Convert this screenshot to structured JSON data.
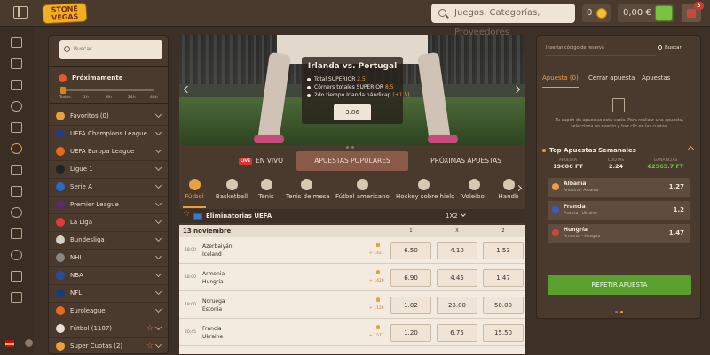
{
  "header": {
    "logo_line1": "STONE",
    "logo_line2": "VEGAS",
    "search_placeholder": "Juegos, Categorías, Proveedores",
    "coins": "0",
    "balance": "0,00 €",
    "notifications_badge": "3"
  },
  "sidebar": {
    "search_placeholder": "Buscar",
    "upcoming": {
      "title": "Próximamente",
      "slider_labels": [
        "Todos",
        "1h",
        "6h",
        "24h",
        "48h"
      ],
      "selected": "Todos"
    },
    "items": [
      {
        "label": "Favoritos (0)"
      },
      {
        "label": "UEFA Champions League"
      },
      {
        "label": "UEFA Europa League"
      },
      {
        "label": "Ligue 1"
      },
      {
        "label": "Serie A"
      },
      {
        "label": "Premier League"
      },
      {
        "label": "La Liga"
      },
      {
        "label": "Bundesliga"
      },
      {
        "label": "NHL"
      },
      {
        "label": "NBA"
      },
      {
        "label": "NFL"
      },
      {
        "label": "Euroleague"
      },
      {
        "label": "Fútbol (1107)"
      },
      {
        "label": "Super Cuotas (2)"
      }
    ]
  },
  "hero": {
    "title": "Irlanda  vs.  Portugal",
    "lines": [
      {
        "label": "Total SUPERIOR",
        "value": "2.5"
      },
      {
        "label": "Córners totales SUPERIOR",
        "value": "8.5"
      },
      {
        "label": "2do tiempo Irlanda hándicap",
        "value": "(+1.5)"
      }
    ],
    "odd": "3.86"
  },
  "tabs": {
    "live_badge": "LIVE",
    "live": "EN VIVO",
    "popular": "APUESTAS POPULARES",
    "upcoming": "PRÓXIMAS APUESTAS"
  },
  "sports": [
    "Fútbol",
    "Basketball",
    "Tenis",
    "Tenis de mesa",
    "Fútbol americano",
    "Hockey sobre hielo",
    "Voleibol",
    "Handb"
  ],
  "competition": {
    "name": "Eliminatorias UEFA",
    "market": "1X2"
  },
  "table": {
    "date": "13 noviembre",
    "cols": [
      "1",
      "X",
      "2"
    ],
    "rows": [
      {
        "time": "18:00",
        "home": "Azerbaiyán",
        "away": "Iceland",
        "more": "+ 1421",
        "odds": [
          "6.50",
          "4.10",
          "1.53"
        ]
      },
      {
        "time": "18:00",
        "home": "Armenia",
        "away": "Hungría",
        "more": "+ 1420",
        "odds": [
          "6.90",
          "4.45",
          "1.47"
        ]
      },
      {
        "time": "18:00",
        "home": "Noruega",
        "away": "Estonia",
        "more": "+ 1126",
        "odds": [
          "1.02",
          "23.00",
          "50.00"
        ]
      },
      {
        "time": "20:45",
        "home": "Francia",
        "away": "Ukraine",
        "more": "+ 1571",
        "odds": [
          "1.20",
          "6.75",
          "15.50"
        ]
      }
    ]
  },
  "betslip": {
    "code_placeholder": "Insertar código de reserva",
    "search": "Buscar",
    "tabs": [
      "Apuesta (0)",
      "Cerrar apuesta",
      "Apuestas"
    ],
    "empty_text": "Tu cupón de apuestas está vacío. Para realizar una apuesta, selecciona un evento y haz clic en las cuotas.",
    "top_title": "Top Apuestas Semanales",
    "stats": [
      {
        "label": "APUESTA",
        "value": "19000 FT"
      },
      {
        "label": "CUOTAS",
        "value": "2.24"
      },
      {
        "label": "GANANCIAS",
        "value": "€2565.7 FT"
      }
    ],
    "picks": [
      {
        "name": "Albania",
        "match": "Andorra - Albania",
        "odd": "1.27"
      },
      {
        "name": "Francia",
        "match": "Francia - Ukraine",
        "odd": "1.2"
      },
      {
        "name": "Hungría",
        "match": "Armenia - Hungría",
        "odd": "1.47"
      }
    ],
    "repeat_button": "REPETIR APUESTA"
  }
}
